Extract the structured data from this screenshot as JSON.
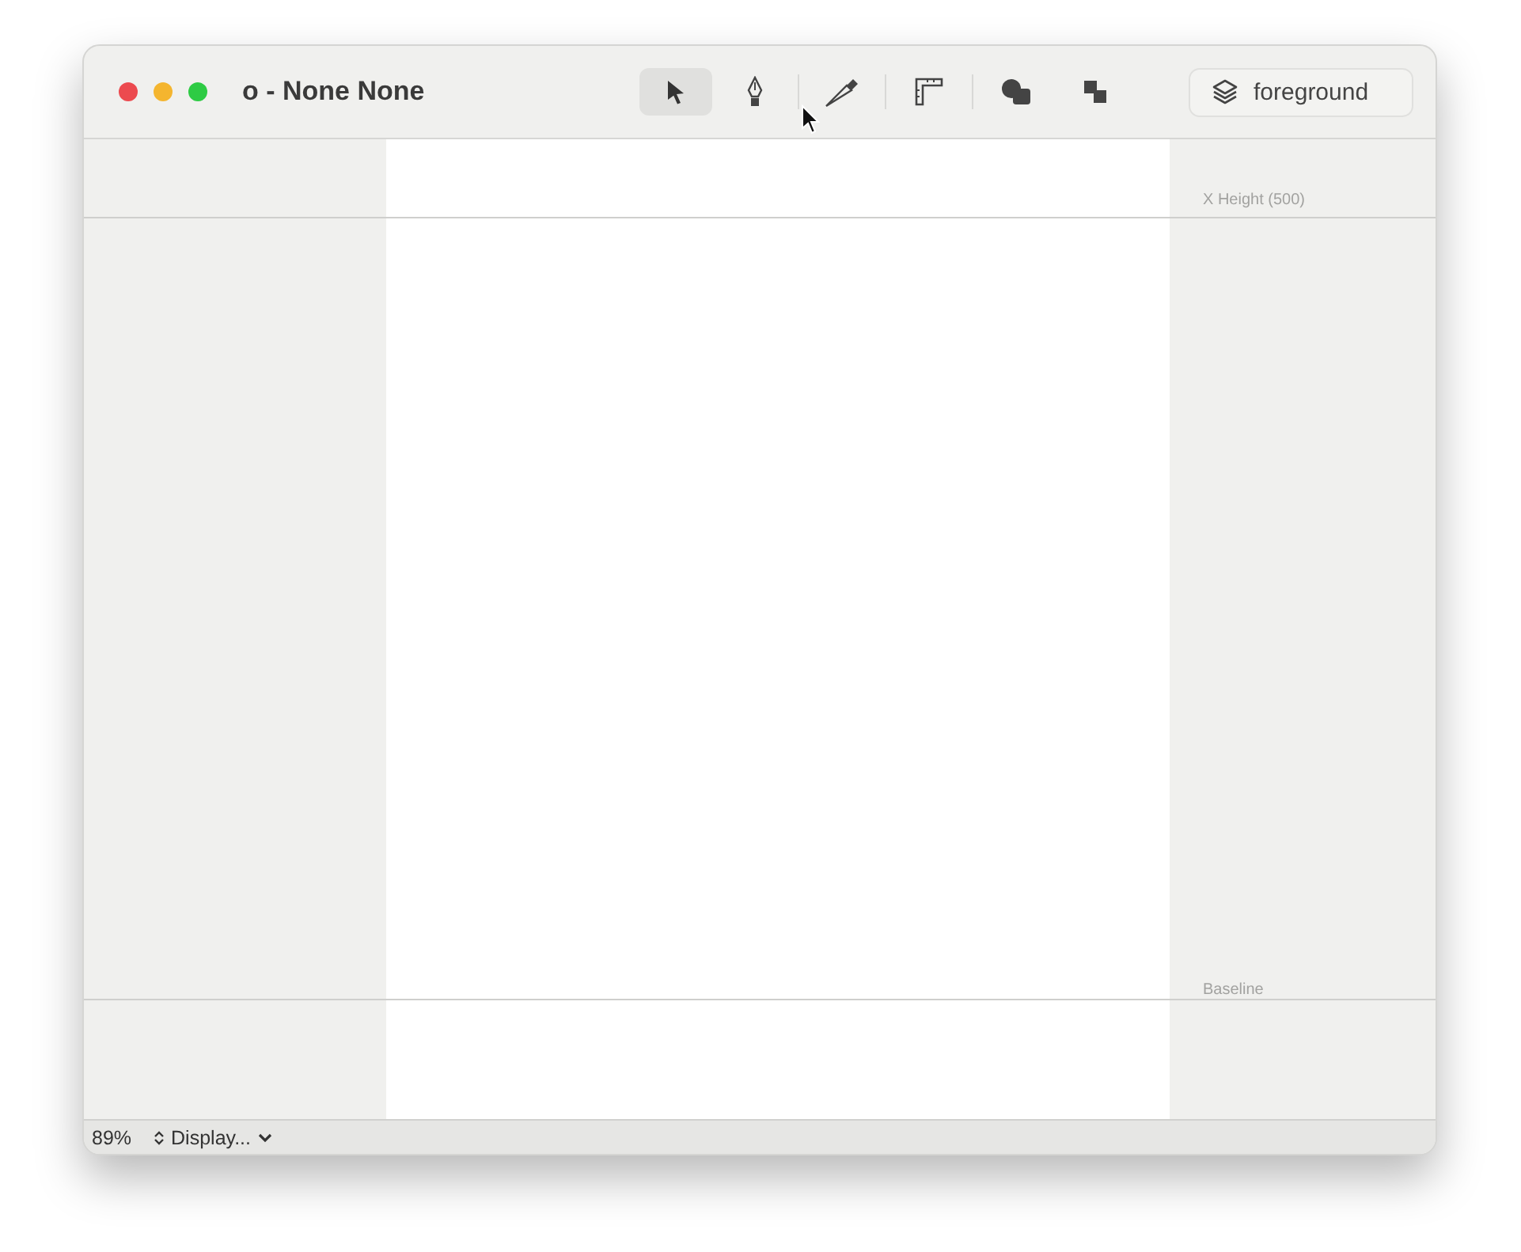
{
  "window": {
    "title": "o - None None"
  },
  "tools": [
    {
      "kind": "pointer",
      "selected": true
    },
    {
      "kind": "pen",
      "selected": false
    },
    {
      "kind": "knife",
      "selected": false
    },
    {
      "kind": "ruler",
      "selected": false
    },
    {
      "kind": "shapes",
      "selected": false
    },
    {
      "kind": "squares",
      "selected": false
    }
  ],
  "layer_button": {
    "label": "foreground"
  },
  "guides": [
    {
      "label": "X Height (500)"
    },
    {
      "label": "Baseline"
    }
  ],
  "status_bar": {
    "zoom": "89%",
    "display": "Display..."
  }
}
